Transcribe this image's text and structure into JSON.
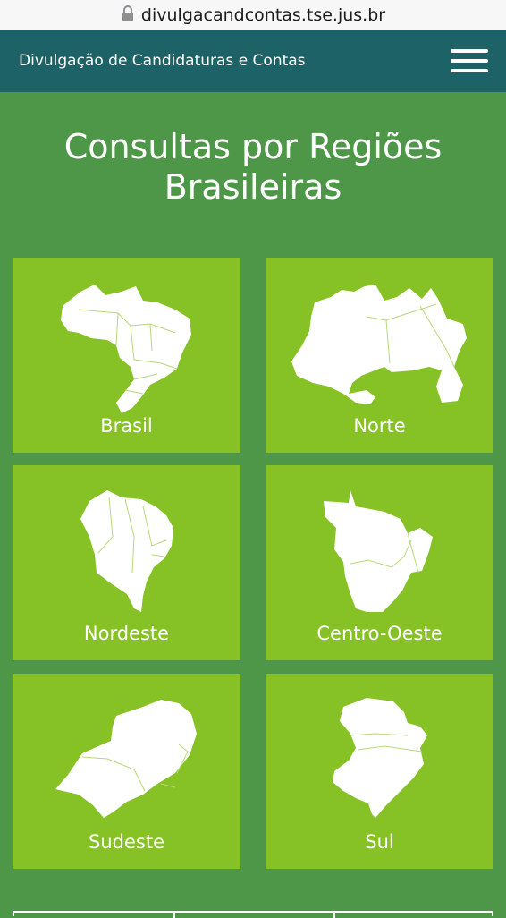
{
  "browser": {
    "url": "divulgacandcontas.tse.jus.br"
  },
  "header": {
    "title": "Divulgação de Candidaturas e Contas"
  },
  "main": {
    "title": "Consultas por Regiões Brasileiras",
    "regions": [
      {
        "label": "Brasil",
        "icon": "brazil-map-icon"
      },
      {
        "label": "Norte",
        "icon": "norte-map-icon"
      },
      {
        "label": "Nordeste",
        "icon": "nordeste-map-icon"
      },
      {
        "label": "Centro-Oeste",
        "icon": "centro-oeste-map-icon"
      },
      {
        "label": "Sudeste",
        "icon": "sudeste-map-icon"
      },
      {
        "label": "Sul",
        "icon": "sul-map-icon"
      }
    ]
  },
  "colors": {
    "background": "#4f9748",
    "header": "#1c6266",
    "tile": "#86c226",
    "text": "#ffffff"
  }
}
